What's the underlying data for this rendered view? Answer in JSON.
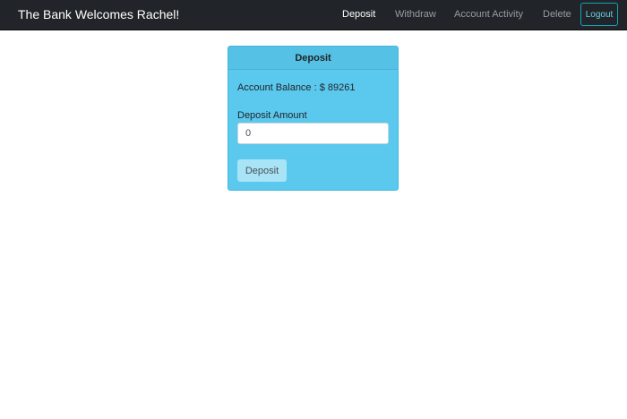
{
  "navbar": {
    "brand": "The Bank Welcomes Rachel!",
    "links": {
      "deposit": "Deposit",
      "withdraw": "Withdraw",
      "activity": "Account Activity",
      "delete": "Delete"
    },
    "logout_label": "Logout",
    "active": "deposit"
  },
  "card": {
    "header": "Deposit",
    "balance_label": "Account Balance : $",
    "balance_value": "89261",
    "amount_label": "Deposit Amount",
    "amount_value": "0",
    "submit_label": "Deposit"
  },
  "colors": {
    "navbar_bg": "#212529",
    "card_bg": "#5bc9ee",
    "accent": "#17a2b8"
  }
}
